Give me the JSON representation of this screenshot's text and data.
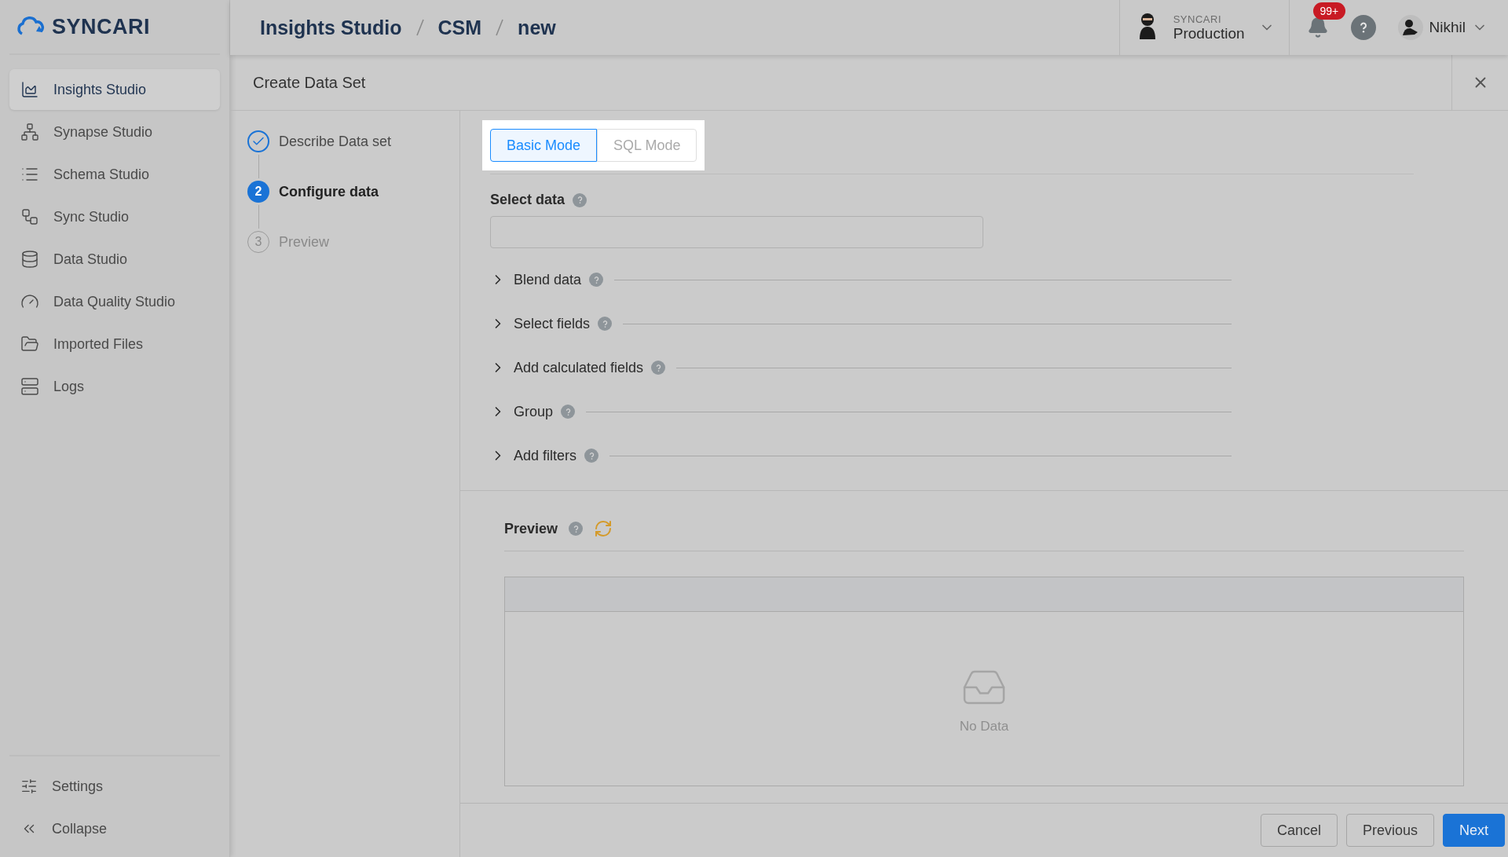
{
  "logo": {
    "name": "SYNCARI"
  },
  "breadcrumb": [
    "Insights Studio",
    "CSM",
    "new"
  ],
  "environment": {
    "org": "SYNCARI",
    "name": "Production"
  },
  "notifications": {
    "badge": "99+"
  },
  "user": {
    "name": "Nikhil"
  },
  "sidebar": {
    "items": [
      {
        "label": "Insights Studio",
        "selected": true
      },
      {
        "label": "Synapse Studio",
        "selected": false
      },
      {
        "label": "Schema Studio",
        "selected": false
      },
      {
        "label": "Sync Studio",
        "selected": false
      },
      {
        "label": "Data Studio",
        "selected": false
      },
      {
        "label": "Data Quality Studio",
        "selected": false
      },
      {
        "label": "Imported Files",
        "selected": false
      },
      {
        "label": "Logs",
        "selected": false
      }
    ],
    "footer": [
      {
        "label": "Settings"
      },
      {
        "label": "Collapse"
      }
    ]
  },
  "dialog": {
    "title": "Create Data Set",
    "steps": [
      {
        "label": "Describe Data set",
        "completed": true,
        "selected": false
      },
      {
        "number": "2",
        "label": "Configure data",
        "completed": false,
        "selected": true
      },
      {
        "number": "3",
        "label": "Preview",
        "completed": false,
        "selected": false
      }
    ],
    "modes": [
      {
        "label": "Basic Mode",
        "selected": true
      },
      {
        "label": "SQL Mode",
        "selected": false
      }
    ],
    "select_data": {
      "label": "Select data"
    },
    "sections": [
      {
        "label": "Blend data",
        "expanded": false
      },
      {
        "label": "Select fields",
        "expanded": false
      },
      {
        "label": "Add calculated fields",
        "expanded": false
      },
      {
        "label": "Group",
        "expanded": false
      },
      {
        "label": "Add filters",
        "expanded": false
      }
    ],
    "preview": {
      "title": "Preview",
      "empty_text": "No Data"
    },
    "buttons": [
      {
        "label": "Cancel",
        "kind": "default"
      },
      {
        "label": "Previous",
        "kind": "default"
      },
      {
        "label": "Next",
        "kind": "primary"
      }
    ]
  }
}
